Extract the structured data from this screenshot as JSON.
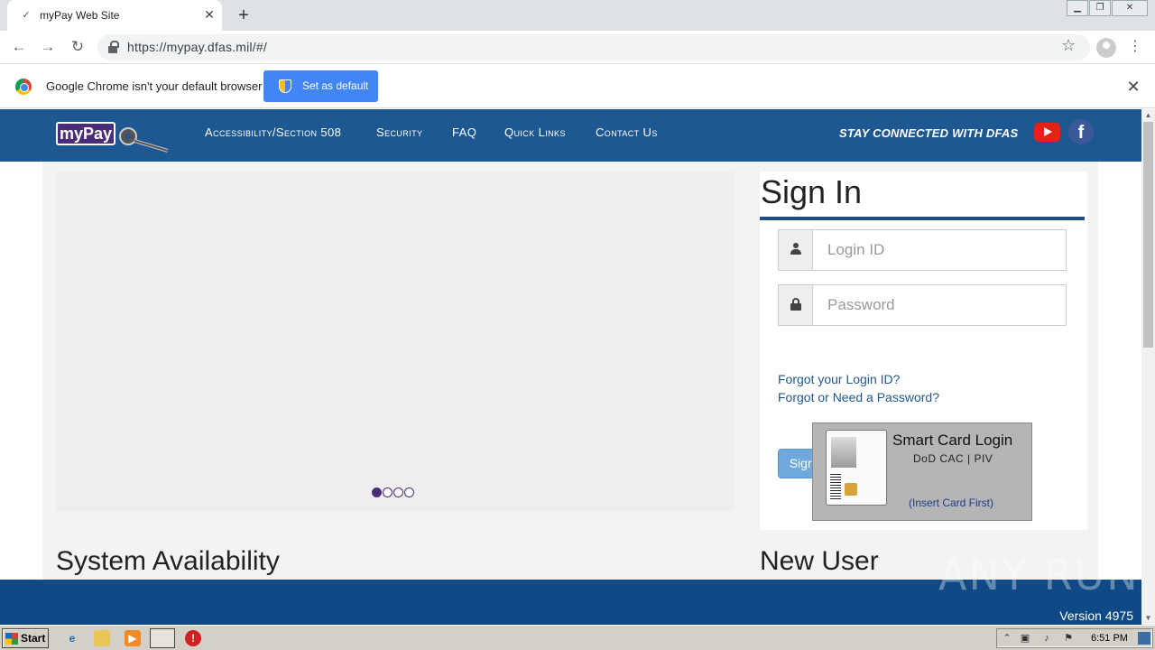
{
  "browser": {
    "tab_title": "myPay Web Site",
    "url": "https://mypay.dfas.mil/#/",
    "infobar_text": "Google Chrome isn't your default browser",
    "set_default_label": "Set as default"
  },
  "site": {
    "logo_text": "myPay",
    "nav": [
      "Accessibility/Section 508",
      "Security",
      "FAQ",
      "Quick Links",
      "Contact Us"
    ],
    "stay_connected": "STAY CONNECTED WITH DFAS",
    "facebook_glyph": "f"
  },
  "signin": {
    "title": "Sign In",
    "login_placeholder": "Login ID",
    "password_placeholder": "Password",
    "button": "Sign In",
    "forgot_login": "Forgot your Login ID?",
    "forgot_password": "Forgot or Need a Password?",
    "smartcard_title": "Smart Card Login",
    "smartcard_sub": "DoD CAC | PIV",
    "smartcard_note": "(Insert Card First)"
  },
  "sections": {
    "system_availability": "System Availability",
    "new_user": "New User"
  },
  "carousel": {
    "slides": 4,
    "active": 1
  },
  "footer": {
    "version": "Version 4975",
    "watermark": "ANY RUN"
  },
  "taskbar": {
    "start": "Start",
    "clock": "6:51 PM"
  },
  "colors": {
    "nav_blue": "#1e5892",
    "footer_blue": "#0f4a86",
    "brand_purple": "#4b2c78"
  }
}
